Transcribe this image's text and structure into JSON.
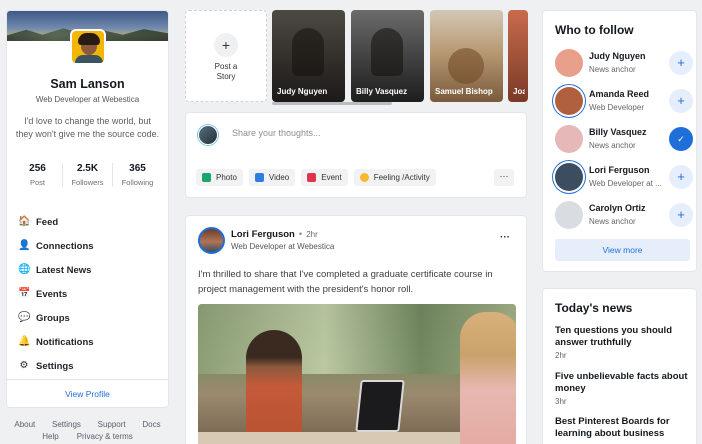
{
  "profile": {
    "name": "Sam Lanson",
    "title": "Web Developer at Webestica",
    "bio": "I'd love to change the world, but they won't give me the source code.",
    "stats": [
      {
        "value": "256",
        "label": "Post"
      },
      {
        "value": "2.5K",
        "label": "Followers"
      },
      {
        "value": "365",
        "label": "Following"
      }
    ],
    "nav": [
      {
        "label": "Feed",
        "icon": "home-icon"
      },
      {
        "label": "Connections",
        "icon": "people-icon"
      },
      {
        "label": "Latest News",
        "icon": "globe-icon"
      },
      {
        "label": "Events",
        "icon": "calendar-icon"
      },
      {
        "label": "Groups",
        "icon": "chat-icon"
      },
      {
        "label": "Notifications",
        "icon": "bell-icon"
      },
      {
        "label": "Settings",
        "icon": "gear-icon"
      }
    ],
    "view_profile": "View Profile"
  },
  "footer": {
    "links_row1": [
      "About",
      "Settings",
      "Support",
      "Docs"
    ],
    "links_row2": [
      "Help",
      "Privacy & terms"
    ]
  },
  "stories": {
    "post_label_1": "Post a",
    "post_label_2": "Story",
    "items": [
      {
        "name": "Judy Nguyen"
      },
      {
        "name": "Billy Vasquez"
      },
      {
        "name": "Samuel Bishop"
      },
      {
        "name": "Joa"
      }
    ]
  },
  "composer": {
    "placeholder": "Share your thoughts...",
    "actions": [
      {
        "label": "Photo",
        "color": "#1aa56a"
      },
      {
        "label": "Video",
        "color": "#2f7de1"
      },
      {
        "label": "Event",
        "color": "#e0344a"
      },
      {
        "label": "Feeling /Activity",
        "color": "#f5b82e"
      }
    ],
    "more": "···"
  },
  "post": {
    "author": "Lori Ferguson",
    "dot": "•",
    "time": "2hr",
    "subtitle": "Web Developer at Webestica",
    "text": "I'm thrilled to share that I've completed a graduate certificate course in project management with the president's honor roll.",
    "more": "···"
  },
  "follow": {
    "title": "Who to follow",
    "people": [
      {
        "name": "Judy Nguyen",
        "role": "News anchor",
        "following": false,
        "avatar": "#e8a08a"
      },
      {
        "name": "Amanda Reed",
        "role": "Web Developer",
        "following": false,
        "avatar": "#b0603e"
      },
      {
        "name": "Billy Vasquez",
        "role": "News anchor",
        "following": true,
        "avatar": "#e6b8b8"
      },
      {
        "name": "Lori Ferguson",
        "role": "Web Developer at ...",
        "following": false,
        "avatar": "#3b4d5e"
      },
      {
        "name": "Carolyn Ortiz",
        "role": "News anchor",
        "following": false,
        "avatar": "#d9dce0"
      }
    ],
    "add": "+",
    "added": "✓",
    "view_more": "View more"
  },
  "news": {
    "title": "Today's news",
    "items": [
      {
        "title": "Ten questions you should answer truthfully",
        "time": "2hr"
      },
      {
        "title": "Five unbelievable facts about money",
        "time": "3hr"
      },
      {
        "title": "Best Pinterest Boards for learning about business",
        "time": ""
      }
    ]
  }
}
